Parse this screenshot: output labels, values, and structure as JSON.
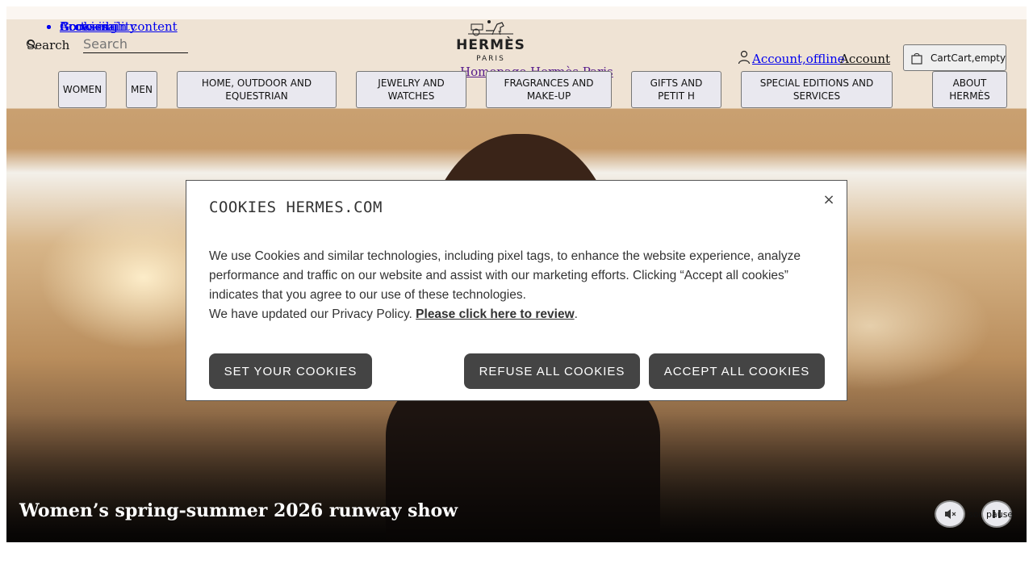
{
  "skip_links": [
    "Go to main content",
    "Accessibility",
    "Cookies",
    "Browsing"
  ],
  "search": {
    "label": "Search",
    "placeholder": "Search"
  },
  "logo": {
    "brand": "HERMÈS",
    "subtitle": "PARIS",
    "home_link": "Homepage Hermès Paris"
  },
  "account": {
    "link": "Account,offline",
    "button": "Account"
  },
  "cart": {
    "label": "CartCart,empty"
  },
  "nav": [
    "WOMEN",
    "MEN",
    "HOME, OUTDOOR AND EQUESTRIAN",
    "JEWELRY AND WATCHES",
    "FRAGRANCES AND MAKE-UP",
    "GIFTS AND PETIT H",
    "SPECIAL EDITIONS AND SERVICES",
    "ABOUT HERMÈS"
  ],
  "hero": {
    "title": "Women’s spring-summer 2026 runway show",
    "mute_label": "sound",
    "play_label": "pause"
  },
  "cookie_modal": {
    "title": "COOKIES HERMES.COM",
    "close": "×",
    "paragraph": "We use Cookies and similar technologies, including pixel tags, to enhance the website experience, analyze performance and traffic on our website and assist with our marketing efforts. Clicking “Accept all cookies” indicates that you agree to our use of these technologies.",
    "policy_prefix": "We have updated our Privacy Policy. ",
    "policy_link": "Please click here to review",
    "policy_suffix": ".",
    "set_button": "SET YOUR COOKIES",
    "refuse_button": "REFUSE ALL COOKIES",
    "accept_button": "ACCEPT ALL COOKIES"
  },
  "colors": {
    "modal_button": "#444444",
    "link": "#0000ee",
    "visited_link": "#551a8b",
    "nav_button_bg": "#e9e8ef"
  }
}
